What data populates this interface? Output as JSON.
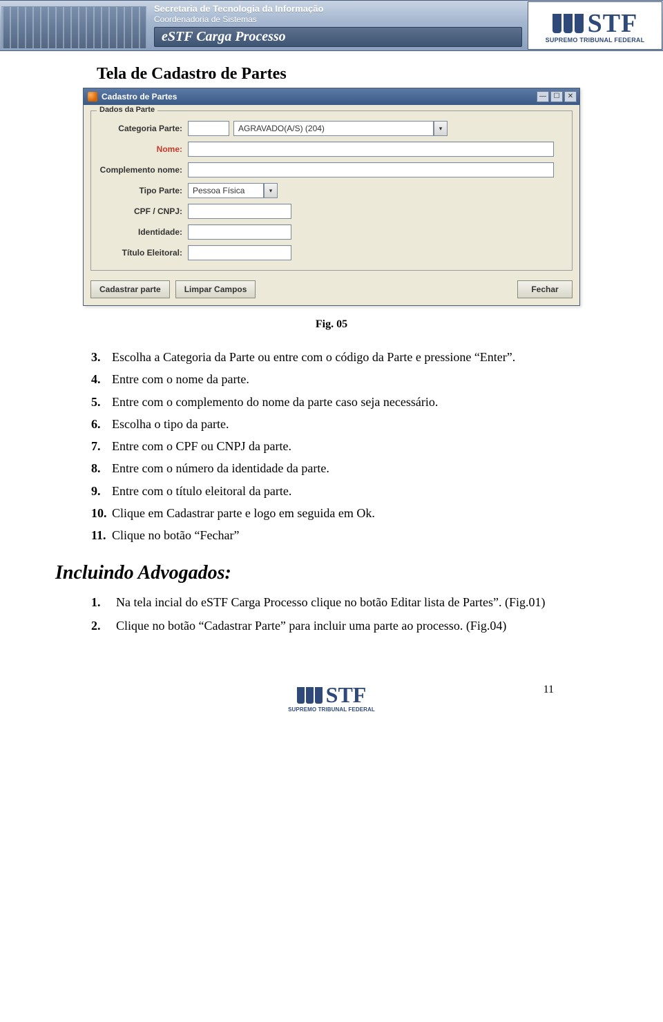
{
  "banner": {
    "line1": "Secretaria de Tecnologia da Informação",
    "line2": "Coordenadoria de Sistemas",
    "title": "eSTF Carga Processo",
    "stf": "STF",
    "stf_sub": "SUPREMO TRIBUNAL FEDERAL"
  },
  "doc_title": "Tela de Cadastro de Partes",
  "window": {
    "title": "Cadastro de Partes",
    "fieldset_legend": "Dados da Parte",
    "labels": {
      "categoria": "Categoria Parte:",
      "nome": "Nome:",
      "complemento": "Complemento nome:",
      "tipo": "Tipo Parte:",
      "cpf": "CPF / CNPJ:",
      "identidade": "Identidade:",
      "titulo_eleitoral": "Título Eleitoral:"
    },
    "values": {
      "categoria_code": "",
      "categoria_select": "AGRAVADO(A/S) (204)",
      "nome": "",
      "complemento": "",
      "tipo_select": "Pessoa Física",
      "cpf": "",
      "identidade": "",
      "titulo_eleitoral": ""
    },
    "buttons": {
      "cadastrar": "Cadastrar parte",
      "limpar": "Limpar Campos",
      "fechar": "Fechar"
    }
  },
  "fig_caption": "Fig. 05",
  "instructions_a": [
    {
      "n": "3.",
      "t": "Escolha a Categoria da Parte ou entre com o código da Parte e pressione “Enter”."
    },
    {
      "n": "4.",
      "t": "Entre com o nome da parte."
    },
    {
      "n": "5.",
      "t": "Entre com o complemento do nome da parte caso seja necessário."
    },
    {
      "n": "6.",
      "t": "Escolha o tipo da parte."
    },
    {
      "n": "7.",
      "t": "Entre com o CPF ou CNPJ da parte."
    },
    {
      "n": "8.",
      "t": "Entre com o número da identidade da parte."
    },
    {
      "n": "9.",
      "t": "Entre com o título eleitoral da parte."
    },
    {
      "n": "10.",
      "t": "Clique em Cadastrar parte e logo em seguida em Ok."
    },
    {
      "n": "11.",
      "t": "Clique no botão “Fechar”"
    }
  ],
  "section_heading": "Incluindo Advogados:",
  "instructions_b": [
    {
      "n": "1.",
      "t": "Na tela incial do eSTF Carga Processo clique no botão Editar lista de Partes”. (Fig.01)"
    },
    {
      "n": "2.",
      "t": "Clique no botão “Cadastrar Parte” para incluir uma parte ao processo. (Fig.04)"
    }
  ],
  "footer": {
    "page": "11",
    "stf": "STF",
    "stf_sub": "SUPREMO TRIBUNAL FEDERAL"
  }
}
